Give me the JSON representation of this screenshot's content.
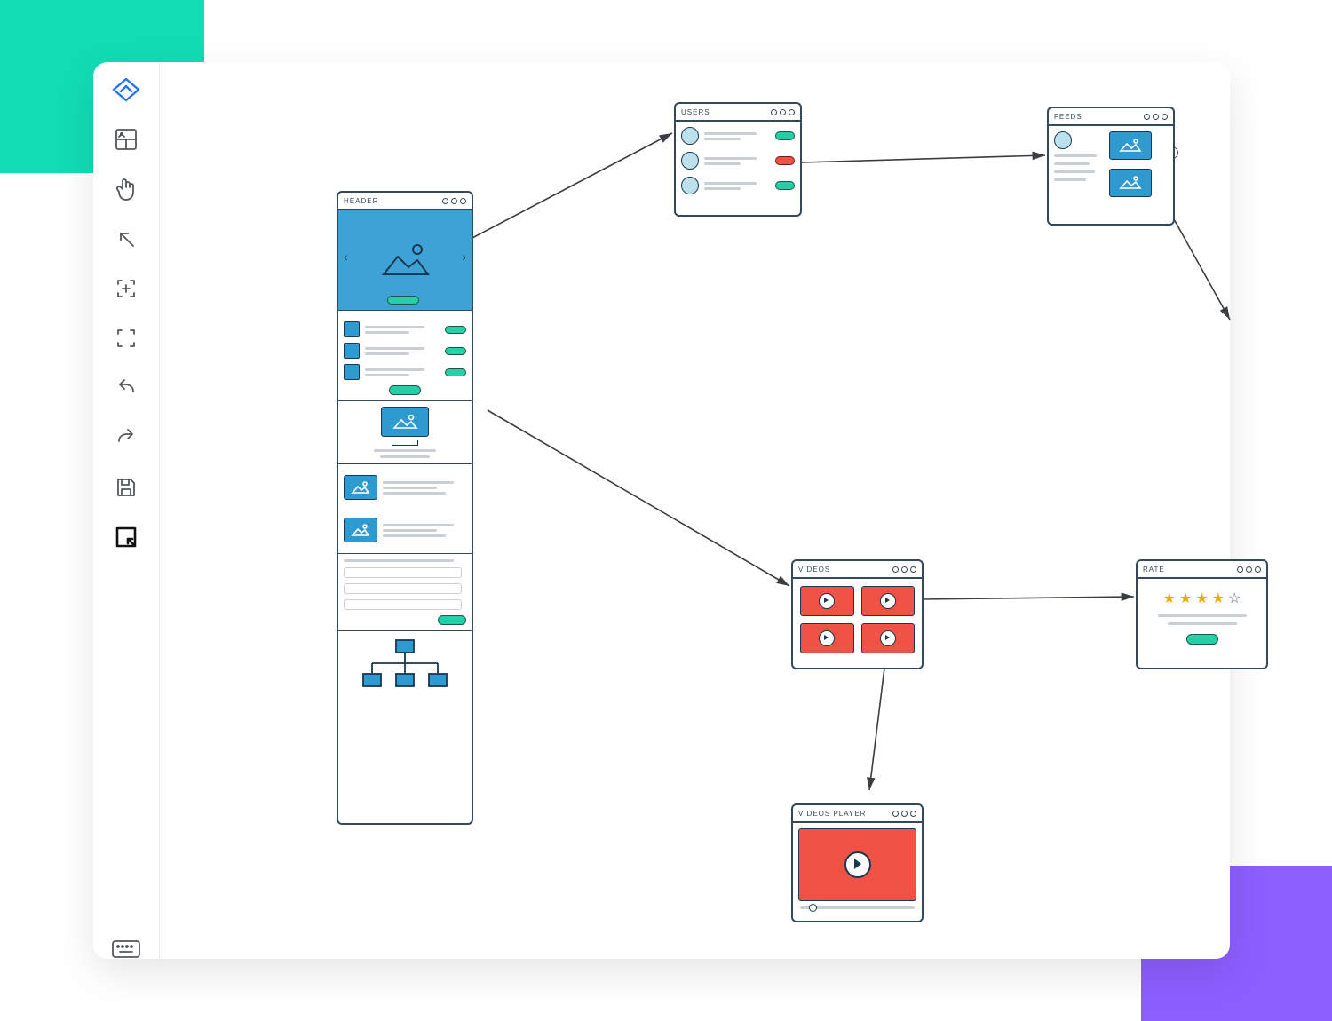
{
  "toolbar": {
    "items": [
      {
        "name": "logo-icon"
      },
      {
        "name": "layout-panel-icon"
      },
      {
        "name": "pointer-hand-icon"
      },
      {
        "name": "arrow-nw-icon"
      },
      {
        "name": "frame-add-icon"
      },
      {
        "name": "frame-icon"
      },
      {
        "name": "undo-icon"
      },
      {
        "name": "redo-icon"
      },
      {
        "name": "save-icon"
      },
      {
        "name": "crop-resize-icon"
      },
      {
        "name": "keyboard-icon"
      }
    ]
  },
  "frames": {
    "header": {
      "title": "HEADER"
    },
    "users": {
      "title": "USERS"
    },
    "feeds": {
      "title": "FEEDS"
    },
    "videos": {
      "title": "VIDEOS"
    },
    "rate": {
      "title": "RATE",
      "stars_filled": 4,
      "stars_total": 5
    },
    "videos_player": {
      "title": "VIDEOS PLAYER"
    }
  }
}
